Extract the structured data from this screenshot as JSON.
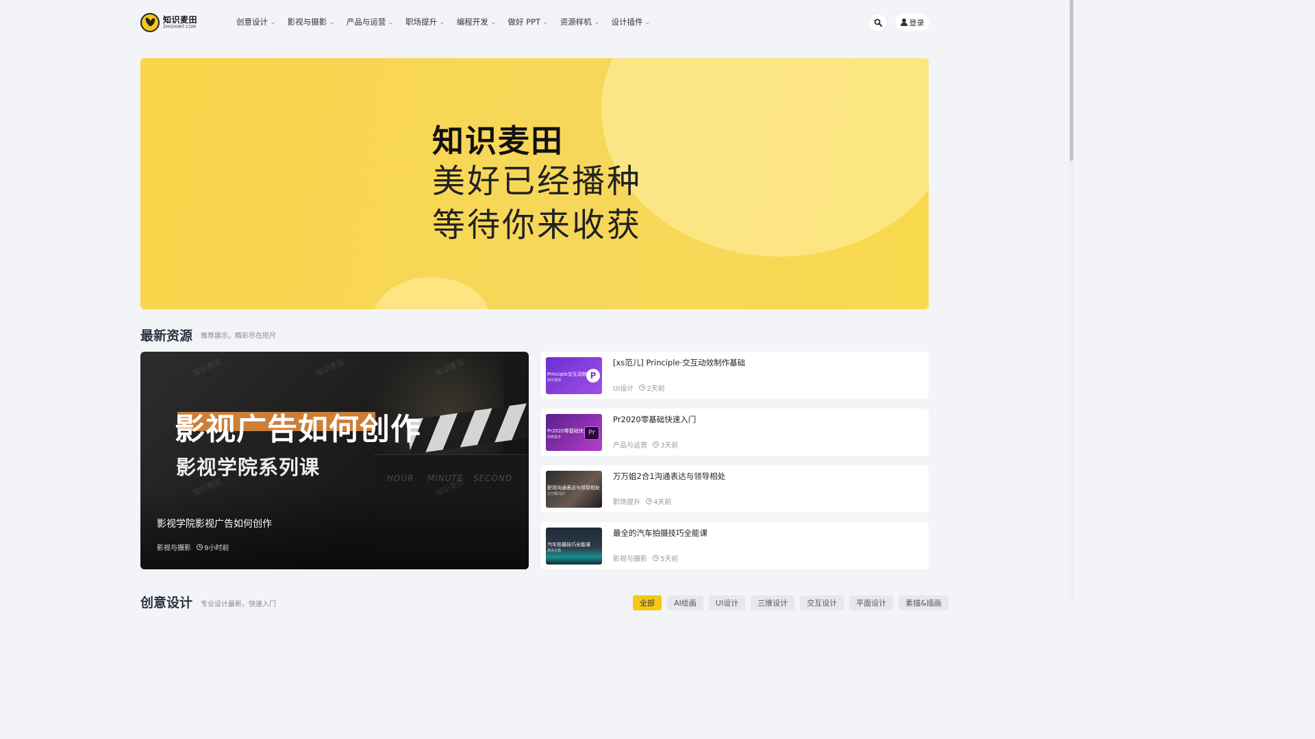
{
  "header": {
    "logo_cn": "知识麦田",
    "logo_en": "ZHISHIMT.COM",
    "nav": [
      {
        "label": "创意设计"
      },
      {
        "label": "影视与摄影"
      },
      {
        "label": "产品与运营"
      },
      {
        "label": "职场提升"
      },
      {
        "label": "编程开发"
      },
      {
        "label": "做好 PPT"
      },
      {
        "label": "资源样机"
      },
      {
        "label": "设计插件"
      }
    ],
    "login_label": "登录"
  },
  "banner": {
    "title": "知识麦田",
    "line1": "美好已经播种",
    "line2": "等待你来收获",
    "colors": {
      "bg": "#f9d64a"
    }
  },
  "latest": {
    "title": "最新资源",
    "subtitle": "推荐展示，精彩尽在咫尺",
    "featured": {
      "image_title": "影视广告如何创作",
      "image_subtitle": "影视学院系列课",
      "caption": "影视学院影视广告如何创作",
      "category": "影视与摄影",
      "time": "9小时前"
    },
    "items": [
      {
        "title": "[xs范儿] Principle·交互动效制作基础",
        "category": "UI设计",
        "time": "2天前",
        "thumb_text": "Principle交互动效",
        "thumb_sub": "制作基础"
      },
      {
        "title": "Pr2020零基础快速入门",
        "category": "产品与运营",
        "time": "3天前",
        "thumb_text": "Pr2020零基础快速入门",
        "thumb_sub": "经典基本"
      },
      {
        "title": "万万姐2合1沟通表达与领导相处",
        "category": "职场提升",
        "time": "4天前",
        "thumb_text": "职场沟通表达与领导相处",
        "thumb_sub": "万万姐2合1"
      },
      {
        "title": "最全的汽车拍摄技巧全能课",
        "category": "影视与摄影",
        "time": "5天前",
        "thumb_text": "汽车拍摄技巧全能课",
        "thumb_sub": "高清主题"
      }
    ]
  },
  "creative": {
    "title": "创意设计",
    "subtitle": "专业设计最新，快速入门",
    "tabs": [
      "全部",
      "AI绘画",
      "UI设计",
      "三维设计",
      "交互设计",
      "平面设计",
      "素描&插画"
    ]
  },
  "colors": {
    "accent": "#f6c817",
    "page_bg": "#f2f4f7"
  }
}
